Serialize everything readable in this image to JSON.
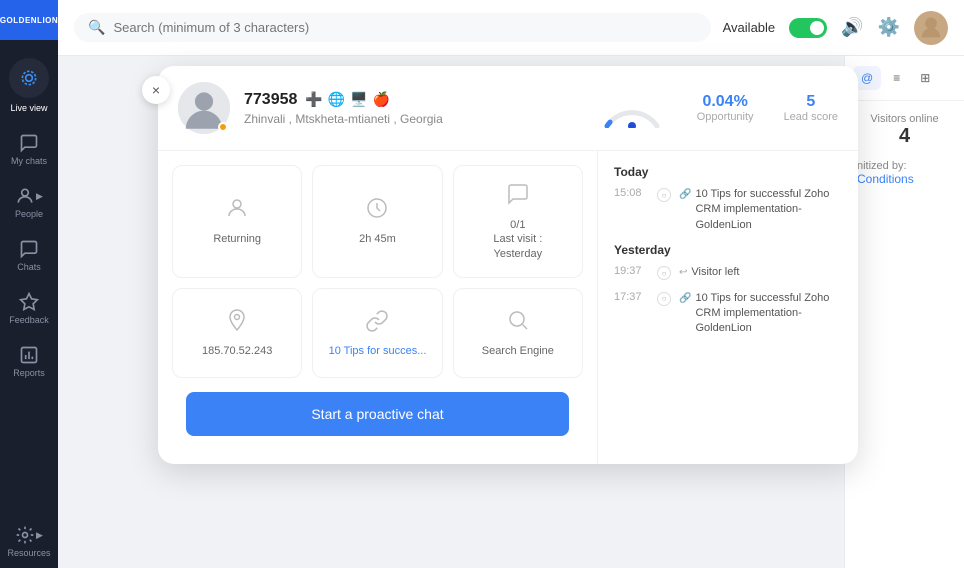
{
  "sidebar": {
    "logo": "GOLDENLION",
    "items": [
      {
        "id": "live-view",
        "label": "Live view",
        "icon": "🔵",
        "active": true
      },
      {
        "id": "my-chats",
        "label": "My chats",
        "icon": "💬",
        "active": false
      },
      {
        "id": "people",
        "label": "People",
        "icon": "👤",
        "active": false
      },
      {
        "id": "chats",
        "label": "Chats",
        "icon": "💬",
        "active": false
      },
      {
        "id": "feedback",
        "label": "Feedback",
        "icon": "⭐",
        "active": false
      },
      {
        "id": "reports",
        "label": "Reports",
        "icon": "📊",
        "active": false
      },
      {
        "id": "resources",
        "label": "Resources",
        "icon": "📁",
        "active": false
      }
    ]
  },
  "topbar": {
    "search_placeholder": "Search (minimum of 3 characters)",
    "available_label": "Available",
    "icons": [
      "volume",
      "settings",
      "avatar"
    ]
  },
  "right_panel": {
    "tabs": [
      "at-icon",
      "list-icon",
      "filter-icon"
    ],
    "visitors_online_label": "Visitors online",
    "visitors_online_count": "4",
    "filter_label": "nitized by:",
    "filter_value": "Conditions"
  },
  "visitor_card": {
    "id": "773958",
    "location": "Zhinvali , Mtskheta-mtianeti , Georgia",
    "opportunity": "0.04%",
    "opportunity_label": "Opportunity",
    "lead_score": "5",
    "lead_score_label": "Lead score",
    "stats": [
      {
        "icon": "person",
        "label": "Returning"
      },
      {
        "icon": "clock",
        "label": "2h 45m"
      },
      {
        "icon": "chat",
        "label": "0/1\nLast visit :\nYesterday"
      }
    ],
    "details": [
      {
        "icon": "pin",
        "label": "185.70.52.243"
      },
      {
        "icon": "link",
        "label": "10 Tips for succes...",
        "is_link": true
      },
      {
        "icon": "search-engine",
        "label": "Search Engine"
      }
    ],
    "timeline": {
      "today": {
        "label": "Today",
        "items": [
          {
            "time": "15:08",
            "text": "10 Tips for successful Zoho CRM implementation-GoldenLion",
            "icon": "link"
          }
        ]
      },
      "yesterday": {
        "label": "Yesterday",
        "items": [
          {
            "time": "19:37",
            "text": "Visitor left",
            "icon": "exit"
          },
          {
            "time": "17:37",
            "text": "10 Tips for successful Zoho CRM implementation-GoldenLion",
            "icon": "link"
          }
        ]
      }
    },
    "cta_button": "Start a proactive chat",
    "close_button": "×"
  }
}
